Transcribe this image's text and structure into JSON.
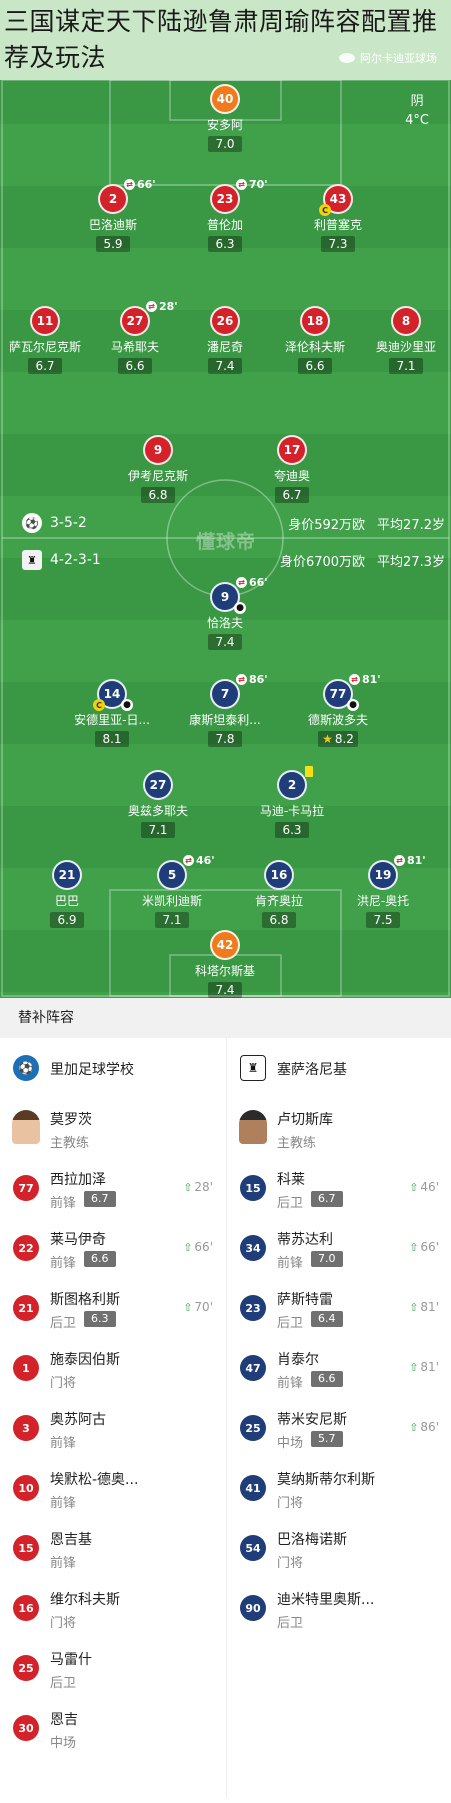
{
  "article": {
    "title": "三国谋定天下陆逊鲁肃周瑜阵容配置推荐及玩法"
  },
  "match": {
    "league": "阿尔卡迪亚球场",
    "weather": "阴",
    "temperature": "4°C",
    "watermark": "懂球帝"
  },
  "teams": {
    "home": {
      "name": "里加足球学校",
      "formation": "3-5-2",
      "value": "身价592万欧",
      "age": "平均27.2岁"
    },
    "away": {
      "name": "塞萨洛尼基",
      "formation": "4-2-3-1",
      "value": "身价6700万欧",
      "age": "平均27.3岁"
    }
  },
  "home_lineup": [
    {
      "num": "40",
      "name": "安多阿",
      "rating": "7.0"
    },
    {
      "num": "2",
      "name": "巴洛迪斯",
      "rating": "5.9",
      "sub": "66'"
    },
    {
      "num": "23",
      "name": "普伦加",
      "rating": "6.3",
      "sub": "70'"
    },
    {
      "num": "43",
      "name": "利普塞克",
      "rating": "7.3",
      "captain": "C"
    },
    {
      "num": "11",
      "name": "萨瓦尔尼克斯",
      "rating": "6.7"
    },
    {
      "num": "27",
      "name": "马希耶夫",
      "rating": "6.6",
      "sub": "28'"
    },
    {
      "num": "26",
      "name": "潘尼奇",
      "rating": "7.4"
    },
    {
      "num": "18",
      "name": "泽伦科夫斯",
      "rating": "6.6"
    },
    {
      "num": "8",
      "name": "奥迪沙里亚",
      "rating": "7.1"
    },
    {
      "num": "9",
      "name": "伊考尼克斯",
      "rating": "6.8"
    },
    {
      "num": "17",
      "name": "夸迪奥",
      "rating": "6.7"
    }
  ],
  "away_lineup": [
    {
      "num": "9",
      "name": "恰洛夫",
      "rating": "7.4",
      "sub": "66'"
    },
    {
      "num": "14",
      "name": "安德里亚-日...",
      "rating": "8.1",
      "captain": "C"
    },
    {
      "num": "7",
      "name": "康斯坦泰利...",
      "rating": "7.8",
      "sub": "86'"
    },
    {
      "num": "77",
      "name": "德斯波多夫",
      "rating": "8.2",
      "sub": "81'"
    },
    {
      "num": "27",
      "name": "奥兹多耶夫",
      "rating": "7.1"
    },
    {
      "num": "2",
      "name": "马迪-卡马拉",
      "rating": "6.3"
    },
    {
      "num": "21",
      "name": "巴巴",
      "rating": "6.9"
    },
    {
      "num": "5",
      "name": "米凯利迪斯",
      "rating": "7.1",
      "sub": "46'"
    },
    {
      "num": "16",
      "name": "肯齐奥拉",
      "rating": "6.8"
    },
    {
      "num": "19",
      "name": "洪尼-奥托",
      "rating": "7.5",
      "sub": "81'"
    },
    {
      "num": "42",
      "name": "科塔尔斯基",
      "rating": "7.4"
    }
  ],
  "subs": {
    "title": "替补阵容",
    "home_coach": {
      "name": "莫罗茨",
      "role": "主教练"
    },
    "away_coach": {
      "name": "卢切斯库",
      "role": "主教练"
    },
    "home": [
      {
        "num": "77",
        "name": "西拉加泽",
        "pos": "前锋",
        "rating": "6.7",
        "time": "28'"
      },
      {
        "num": "22",
        "name": "莱马伊奇",
        "pos": "前锋",
        "rating": "6.6",
        "time": "66'"
      },
      {
        "num": "21",
        "name": "斯图格利斯",
        "pos": "后卫",
        "rating": "6.3",
        "time": "70'"
      },
      {
        "num": "1",
        "name": "施泰因伯斯",
        "pos": "门将"
      },
      {
        "num": "3",
        "name": "奥苏阿古",
        "pos": "前锋"
      },
      {
        "num": "10",
        "name": "埃默松-德奥...",
        "pos": "前锋"
      },
      {
        "num": "15",
        "name": "恩吉基",
        "pos": "前锋"
      },
      {
        "num": "16",
        "name": "维尔科夫斯",
        "pos": "门将"
      },
      {
        "num": "25",
        "name": "马雷什",
        "pos": "后卫"
      },
      {
        "num": "30",
        "name": "恩吉",
        "pos": "中场"
      }
    ],
    "away": [
      {
        "num": "15",
        "name": "科莱",
        "pos": "后卫",
        "rating": "6.7",
        "time": "46'"
      },
      {
        "num": "34",
        "name": "蒂苏达利",
        "pos": "前锋",
        "rating": "7.0",
        "time": "66'"
      },
      {
        "num": "23",
        "name": "萨斯特雷",
        "pos": "后卫",
        "rating": "6.4",
        "time": "81'"
      },
      {
        "num": "47",
        "name": "肖泰尔",
        "pos": "前锋",
        "rating": "6.6",
        "time": "81'"
      },
      {
        "num": "25",
        "name": "蒂米安尼斯",
        "pos": "中场",
        "rating": "5.7",
        "time": "86'"
      },
      {
        "num": "41",
        "name": "莫纳斯蒂尔利斯",
        "pos": "门将"
      },
      {
        "num": "54",
        "name": "巴洛梅诺斯",
        "pos": "门将"
      },
      {
        "num": "90",
        "name": "迪米特里奥斯...",
        "pos": "后卫"
      }
    ]
  },
  "colors": {
    "home": "#d32229",
    "away": "#1f3d79",
    "goalkeeper_home": "#f07a1c",
    "pitch": "#41a14b"
  },
  "icons": {
    "sub_out": "sub-out-icon",
    "captain": "captain-icon",
    "goal": "ball-icon",
    "sub_in": "sub-in-arrow-icon"
  }
}
